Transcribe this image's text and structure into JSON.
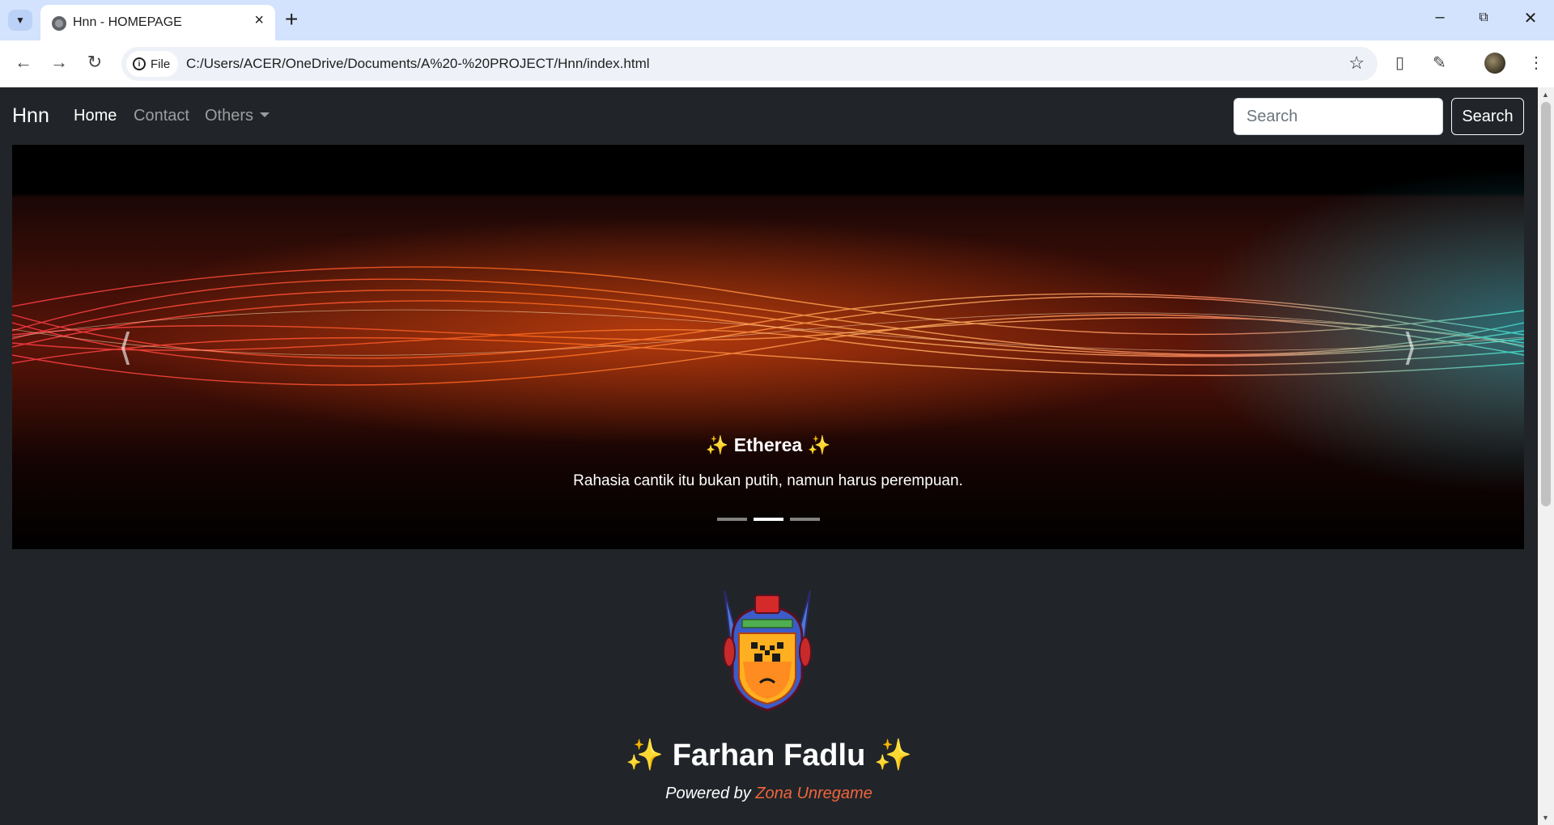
{
  "browser": {
    "tab_title": "Hnn - HOMEPAGE",
    "chip_label": "File",
    "url": "C:/Users/ACER/OneDrive/Documents/A%20-%20PROJECT/Hnn/index.html"
  },
  "navbar": {
    "brand": "Hnn",
    "links": [
      {
        "label": "Home",
        "active": true
      },
      {
        "label": "Contact",
        "active": false
      },
      {
        "label": "Others",
        "active": false
      }
    ],
    "search_placeholder": "Search",
    "search_button": "Search"
  },
  "carousel": {
    "title": "✨ Etherea ✨",
    "text": "Rahasia cantik itu bukan putih, namun harus perempuan.",
    "slide_count": 3,
    "active_index": 1
  },
  "profile": {
    "name": "✨ Farhan Fadlu ✨",
    "powered_prefix": "Powered by ",
    "powered_link": "Zona Unregame"
  },
  "colors": {
    "page_bg": "#212529",
    "accent_link": "#f0643c",
    "tabstrip": "#d3e3fd"
  }
}
